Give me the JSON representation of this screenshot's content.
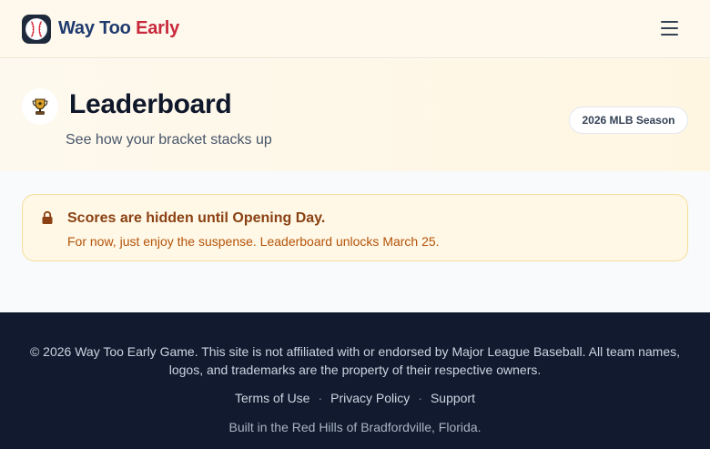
{
  "header": {
    "logo_icon": "baseball-icon",
    "brand_part1": "Way Too",
    "brand_part2": "Early",
    "menu_icon": "hamburger-icon"
  },
  "hero": {
    "icon": "trophy-icon",
    "title": "Leaderboard",
    "subtitle": "See how your bracket stacks up",
    "season_badge": "2026 MLB Season"
  },
  "notice": {
    "icon": "lock-icon",
    "title": "Scores are hidden until Opening Day.",
    "text": "For now, just enjoy the suspense. Leaderboard unlocks March 25."
  },
  "footer": {
    "copyright": "© 2026 Way Too Early Game. This site is not affiliated with or endorsed by Major League Baseball. All team names, logos, and trademarks are the property of their respective owners.",
    "links": [
      {
        "label": "Terms of Use"
      },
      {
        "label": "Privacy Policy"
      },
      {
        "label": "Support"
      }
    ],
    "separator": "·",
    "built_in": "Built in the Red Hills of Bradfordville, Florida."
  },
  "colors": {
    "brand_navy": "#1e3a6e",
    "brand_red": "#c8283c",
    "notice_bg": "#fff8e6",
    "notice_border": "#f6dd9a",
    "footer_bg": "#111a2e"
  }
}
